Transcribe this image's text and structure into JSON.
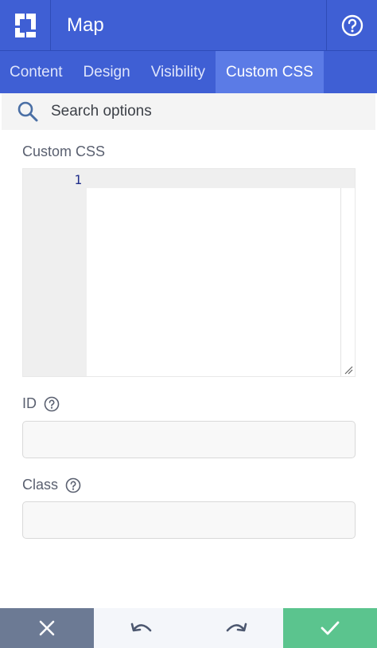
{
  "header": {
    "title": "Map",
    "logo_icon": "builder-logo-icon",
    "help_icon": "help-circle-icon"
  },
  "tabs": [
    {
      "label": "Content",
      "active": false
    },
    {
      "label": "Design",
      "active": false
    },
    {
      "label": "Visibility",
      "active": false
    },
    {
      "label": "Custom CSS",
      "active": true
    }
  ],
  "search": {
    "placeholder": "Search options",
    "icon": "search-icon"
  },
  "custom_css": {
    "label": "Custom CSS",
    "line_numbers": [
      "1"
    ],
    "value": ""
  },
  "id_field": {
    "label": "ID",
    "value": ""
  },
  "class_field": {
    "label": "Class",
    "value": ""
  },
  "footer": {
    "cancel_icon": "close-icon",
    "undo_icon": "undo-icon",
    "redo_icon": "redo-icon",
    "confirm_icon": "check-icon"
  },
  "colors": {
    "header_bg": "#3f5fd4",
    "active_tab_bg": "#5b7be6",
    "cancel_bg": "#6c7a94",
    "confirm_bg": "#5bc48e"
  }
}
